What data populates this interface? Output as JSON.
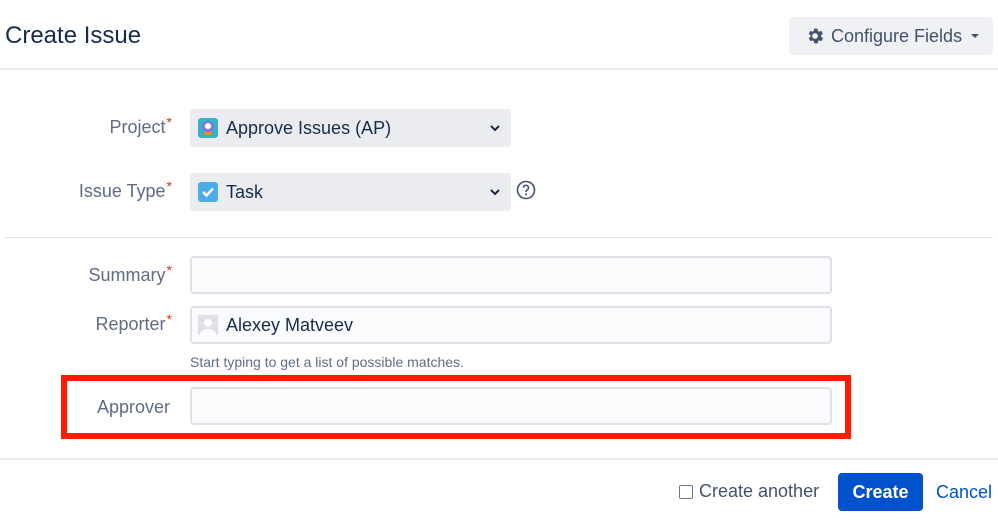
{
  "header": {
    "title": "Create Issue",
    "configure_fields_label": "Configure Fields"
  },
  "form": {
    "required_marker": "*",
    "project": {
      "label": "Project",
      "value": "Approve Issues (AP)",
      "icon": "project-avatar-icon"
    },
    "issue_type": {
      "label": "Issue Type",
      "value": "Task",
      "icon": "task-checkbox-icon"
    },
    "summary": {
      "label": "Summary",
      "value": ""
    },
    "reporter": {
      "label": "Reporter",
      "value": "Alexey Matveev",
      "hint": "Start typing to get a list of possible matches."
    },
    "approver": {
      "label": "Approver",
      "value": ""
    }
  },
  "footer": {
    "create_another_label": "Create another",
    "create_label": "Create",
    "cancel_label": "Cancel"
  },
  "colors": {
    "primary": "#0052cc",
    "required": "#de350b",
    "highlight": "#ff1a00"
  }
}
